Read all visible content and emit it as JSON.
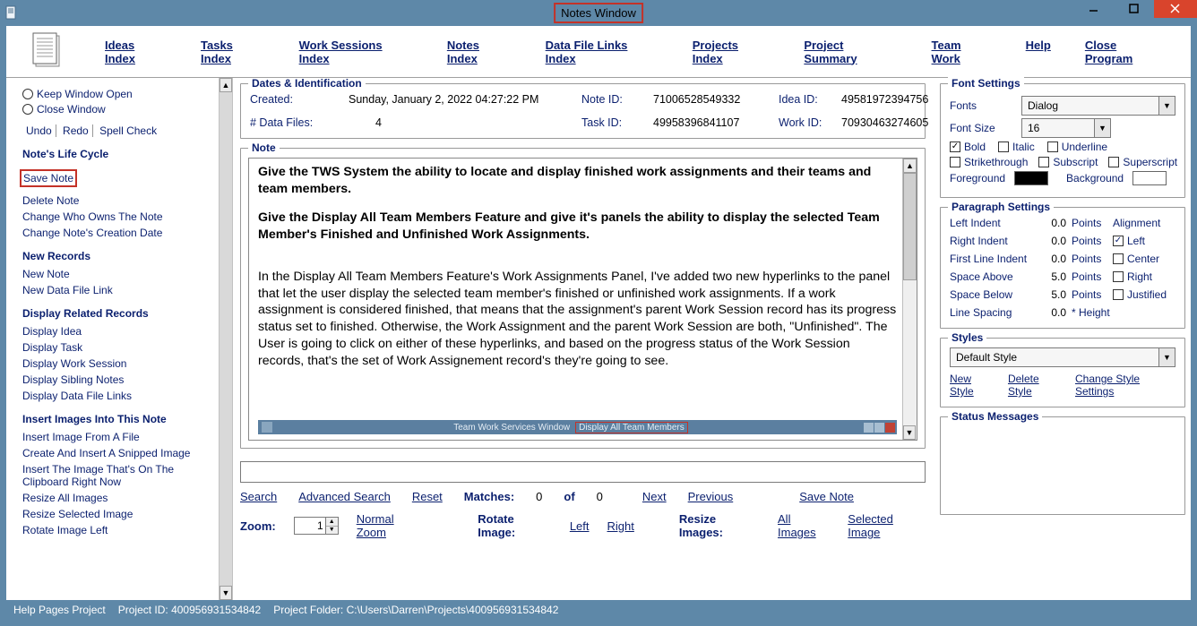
{
  "window": {
    "title": "Notes Window"
  },
  "nav": {
    "ideas": "Ideas Index",
    "tasks": "Tasks Index",
    "work_sessions": "Work Sessions Index",
    "notes": "Notes Index",
    "data_links": "Data File Links Index",
    "projects": "Projects Index",
    "summary": "Project Summary",
    "team": "Team Work",
    "help": "Help",
    "close": "Close Program"
  },
  "left": {
    "keep_open": "Keep Window Open",
    "close_window": "Close Window",
    "undo": "Undo",
    "redo": "Redo",
    "spell": "Spell Check",
    "sec_lifecycle": "Note's Life Cycle",
    "save_note": "Save Note",
    "delete_note": "Delete Note",
    "change_owner": "Change Who Owns The Note",
    "change_date": "Change Note's Creation Date",
    "sec_new": "New Records",
    "new_note": "New Note",
    "new_data_link": "New Data File Link",
    "sec_related": "Display Related Records",
    "disp_idea": "Display Idea",
    "disp_task": "Display Task",
    "disp_ws": "Display Work Session",
    "disp_siblings": "Display Sibling Notes",
    "disp_links": "Display Data File Links",
    "sec_images": "Insert Images Into This Note",
    "img_file": "Insert Image From A File",
    "img_snip": "Create And Insert A Snipped Image",
    "img_clip1": "Insert The Image That's On The",
    "img_clip2": "Clipboard Right Now",
    "resize_all": "Resize All Images",
    "resize_sel": "Resize Selected Image",
    "rotate_left": "Rotate Image Left"
  },
  "dates_id": {
    "legend": "Dates & Identification",
    "created_lbl": "Created:",
    "created_val": "Sunday, January 2, 2022   04:27:22 PM",
    "num_files_lbl": "# Data Files:",
    "num_files_val": "4",
    "note_id_lbl": "Note ID:",
    "note_id_val": "71006528549332",
    "task_id_lbl": "Task ID:",
    "task_id_val": "49958396841107",
    "idea_id_lbl": "Idea ID:",
    "idea_id_val": "49581972394756",
    "work_id_lbl": "Work ID:",
    "work_id_val": "70930463274605"
  },
  "note": {
    "legend": "Note",
    "p1": "Give the TWS System the ability to locate and display finished work assignments and their teams and team members.",
    "p2": "Give the Display All Team Members Feature and give it's panels the ability to display the selected Team Member's Finished and Unfinished Work Assignments.",
    "p3": "In the Display All Team Members Feature's Work Assignments Panel, I've added two new hyperlinks to the panel that let the user display the selected team member's finished or unfinished work assignments. If a work assignment is considered finished, that means that the assignment's parent Work Session record has its progress status set to finished. Otherwise, the Work Assignment and the parent Work Session are both, \"Unfinished\". The User is going to click on either of these hyperlinks, and based on the progress status of the Work Session records, that's the set of Work Assignement record's they're going to see.",
    "inner_tab1": "Team Work Services Window",
    "inner_tab2": "Display All Team Members"
  },
  "search": {
    "search": "Search",
    "adv": "Advanced Search",
    "reset": "Reset",
    "matches_lbl": "Matches:",
    "matches_val": "0",
    "of_lbl": "of",
    "of_val": "0",
    "next": "Next",
    "prev": "Previous",
    "save": "Save Note"
  },
  "zoom": {
    "zoom_lbl": "Zoom:",
    "zoom_val": "1",
    "normal": "Normal Zoom",
    "rotate_lbl": "Rotate Image:",
    "left": "Left",
    "right": "Right",
    "resize_lbl": "Resize Images:",
    "all": "All Images",
    "sel": "Selected Image"
  },
  "font": {
    "legend": "Font Settings",
    "fonts_lbl": "Fonts",
    "fonts_val": "Dialog",
    "size_lbl": "Font Size",
    "size_val": "16",
    "bold": "Bold",
    "italic": "Italic",
    "underline": "Underline",
    "strike": "Strikethrough",
    "sub": "Subscript",
    "super": "Superscript",
    "fg_lbl": "Foreground",
    "bg_lbl": "Background"
  },
  "para": {
    "legend": "Paragraph Settings",
    "left_indent": "Left Indent",
    "right_indent": "Right Indent",
    "first_line": "First Line Indent",
    "space_above": "Space Above",
    "space_below": "Space Below",
    "line_spacing": "Line Spacing",
    "v_left": "0.0",
    "v_right": "0.0",
    "v_first": "0.0",
    "v_above": "5.0",
    "v_below": "5.0",
    "v_line": "0.0",
    "points": "Points",
    "height": "* Height",
    "align_lbl": "Alignment",
    "a_left": "Left",
    "a_center": "Center",
    "a_right": "Right",
    "a_just": "Justified"
  },
  "styles": {
    "legend": "Styles",
    "val": "Default Style",
    "new_s": "New Style",
    "del_s": "Delete Style",
    "chg_s": "Change Style Settings"
  },
  "status": {
    "legend": "Status Messages"
  },
  "footer": {
    "help": "Help Pages Project",
    "pid": "Project ID:  400956931534842",
    "folder": "Project Folder:  C:\\Users\\Darren\\Projects\\400956931534842"
  }
}
